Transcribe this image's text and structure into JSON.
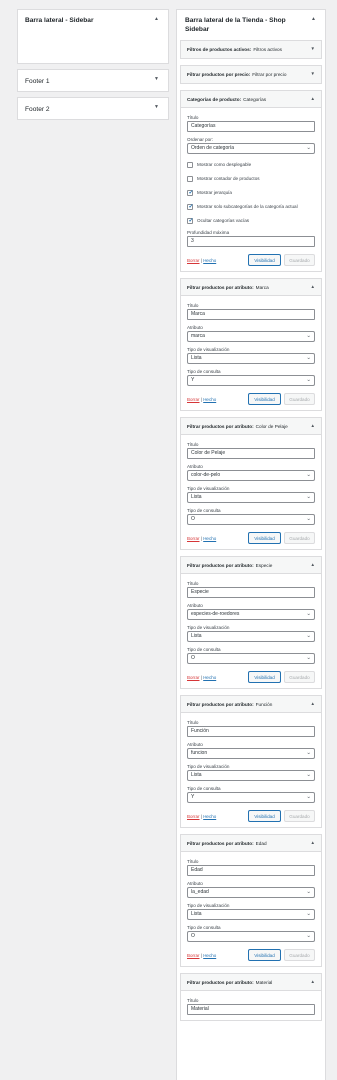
{
  "left": {
    "main_title": "Barra lateral - Sidebar",
    "footers": [
      "Footer 1",
      "Footer 2"
    ]
  },
  "right": {
    "title": "Barra lateral de la Tienda - Shop Sidebar",
    "collapsed": [
      {
        "type": "Filtros de productos activos:",
        "name": "Filtros activos"
      },
      {
        "type": "Filtrar productos por precio:",
        "name": "Filtrar por precio"
      }
    ],
    "categories": {
      "type": "Categorías de producto:",
      "name": "Categorías",
      "title_label": "Título",
      "title_value": "Categorías",
      "order_label": "Ordenar por:",
      "order_value": "Orden de categoría",
      "options": [
        {
          "label": "Mostrar como desplegable",
          "checked": false
        },
        {
          "label": "Mostrar contador de productos",
          "checked": false
        },
        {
          "label": "Mostrar jerarquía",
          "checked": true
        },
        {
          "label": "Mostrar solo subcategorías de la categoría actual",
          "checked": true
        },
        {
          "label": "Ocultar categorías vacías",
          "checked": true
        }
      ],
      "depth_label": "Profundidad máxima",
      "depth_value": "3"
    },
    "labels": {
      "titulo": "Título",
      "atributo": "Atributo",
      "tipo_vis": "Tipo de visualización",
      "tipo_con": "Tipo de consulta",
      "borrar": "Borrar",
      "sep": " | ",
      "hecho": "Hecho",
      "visibilidad": "Visibilidad",
      "guardado": "Guardado",
      "attr_prefix": "Filtrar productos por atributo:"
    },
    "attr_widgets": [
      {
        "name": "Marca",
        "title": "Marca",
        "attr": "marca",
        "display": "Lista",
        "query": "Y"
      },
      {
        "name": "Color de Pelaje",
        "title": "Color de Pelaje",
        "attr": "color-de-pelo",
        "display": "Lista",
        "query": "O"
      },
      {
        "name": "Especie",
        "title": "Especie",
        "attr": "especies-de-roedores",
        "display": "Lista",
        "query": "O"
      },
      {
        "name": "Función",
        "title": "Función",
        "attr": "funcion",
        "display": "Lista",
        "query": "Y"
      },
      {
        "name": "Edad",
        "title": "Edad",
        "attr": "la_edad",
        "display": "Lista",
        "query": "O"
      },
      {
        "name": "Material",
        "title": "Material",
        "attr": "",
        "display": "",
        "query": ""
      }
    ]
  }
}
